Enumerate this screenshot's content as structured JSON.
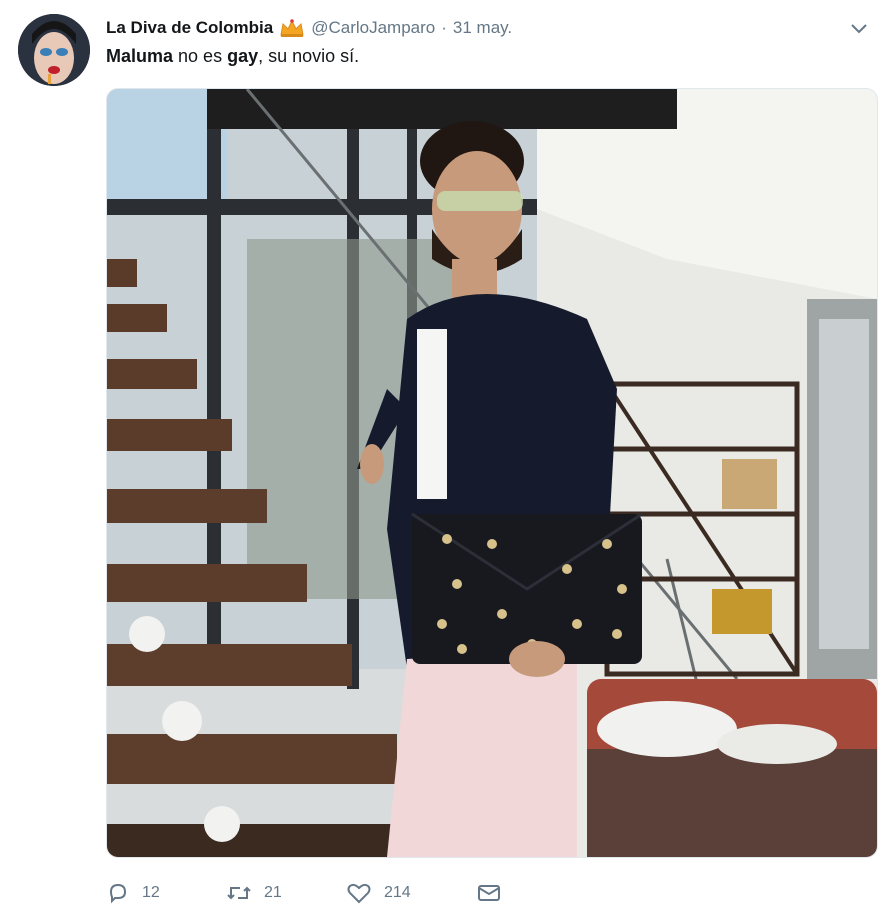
{
  "tweet": {
    "author_name": "La Diva de Colombia",
    "author_handle": "@CarloJamparo",
    "separator": "·",
    "date": "31 may.",
    "text_parts": {
      "bold1": "Maluma",
      "plain1": " no es ",
      "bold2": "gay",
      "plain2": ", su novio sí."
    }
  },
  "actions": {
    "reply_count": "12",
    "retweet_count": "21",
    "like_count": "214"
  },
  "colors": {
    "text": "#14171a",
    "muted": "#657786",
    "border": "#e1e8ed"
  },
  "icons": [
    "avatar",
    "crown-icon",
    "chevron-down-icon",
    "reply-icon",
    "retweet-icon",
    "like-icon",
    "message-icon"
  ]
}
